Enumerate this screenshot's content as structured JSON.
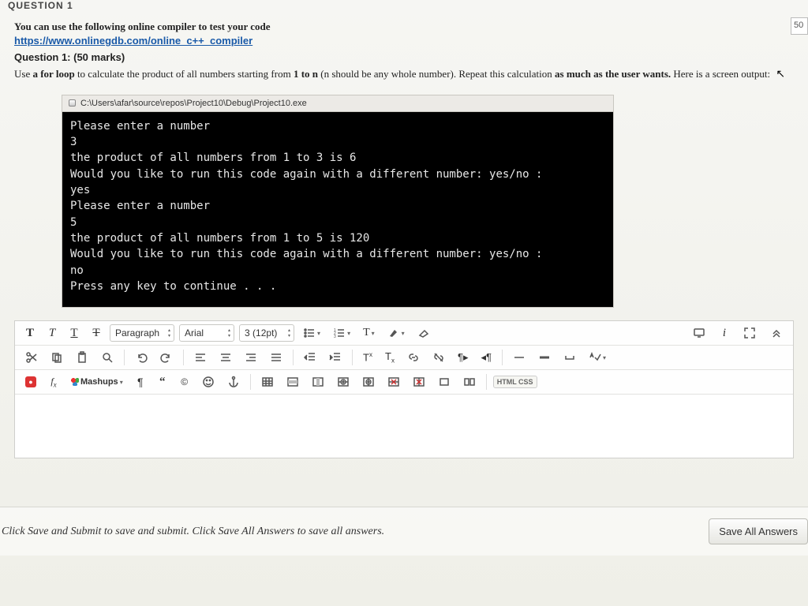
{
  "header_cut": "QUESTION 1",
  "points_box": "50",
  "intro_text": "You can use the following online compiler to test your code",
  "compiler_link": "https://www.onlinegdb.com/online_c++_compiler",
  "q_heading": "Question 1: (50 marks)",
  "q_body_pre": "Use ",
  "q_body_em1": "a for loop",
  "q_body_mid": " to calculate the product of all numbers starting from ",
  "q_body_em2": "1 to n",
  "q_body_mid2": " (n should be any whole number). Repeat this calculation ",
  "q_body_em3": "as much as the user wants.",
  "q_body_end": " Here is a screen output:",
  "console_title": "C:\\Users\\afar\\source\\repos\\Project10\\Debug\\Project10.exe",
  "console_lines": "Please enter a number\n3\nthe product of all numbers from 1 to 3 is 6\nWould you like to run this code again with a different number: yes/no :\nyes\nPlease enter a number\n5\nthe product of all numbers from 1 to 5 is 120\nWould you like to run this code again with a different number: yes/no :\nno\nPress any key to continue . . .",
  "toolbar": {
    "format_sel": "Paragraph",
    "font_sel": "Arial",
    "size_sel": "3 (12pt)",
    "mashups": "Mashups",
    "htmlcss": "HTML CSS"
  },
  "footer_text": "Click Save and Submit to save and submit. Click Save All Answers to save all answers.",
  "save_all": "Save All Answers"
}
